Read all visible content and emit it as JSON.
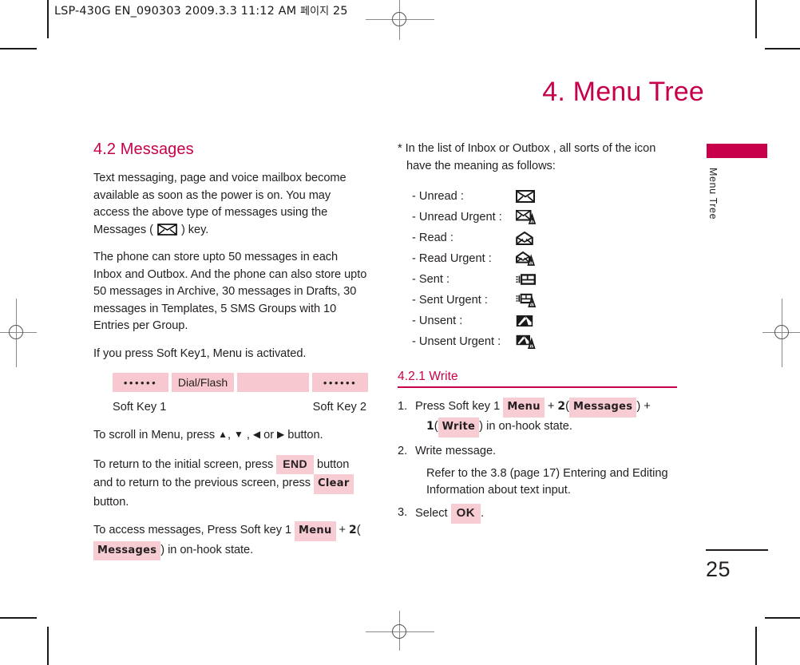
{
  "proof_header": {
    "text": "LSP-430G EN_090303  2009.3.3 11:12 AM",
    "korean": "페이지",
    "page": "25"
  },
  "chapter": {
    "title": "4. Menu Tree",
    "side_tab_label": "Menu Tree",
    "accent_color": "#c8004b",
    "chip_color": "#f7ccd3"
  },
  "left_column": {
    "section_title": "4.2 Messages",
    "paragraph_1_a": "Text messaging, page and voice mailbox become available as soon as the power is on. You may access the above type of messages using the Messages",
    "paragraph_1_b": ") key.",
    "paren_open": "(",
    "paragraph_2": "The phone can store upto 50 messages in each Inbox and Outbox. And the phone can also store upto 50 messages in Archive, 30 messages in Drafts, 30 messages in Templates, 5 SMS Groups with 10 Entries per Group.",
    "paragraph_3": "If you press Soft Key1, Menu is activated.",
    "softkey_strip": {
      "cell_1": "••••••",
      "cell_2": "Dial/Flash",
      "cell_3": "",
      "cell_4": "••••••",
      "left_label": "Soft Key 1",
      "right_label": "Soft Key 2"
    },
    "scroll_line": {
      "prefix": "To scroll in Menu, press ",
      "up": "▲",
      "sep1": ", ",
      "down": "▼",
      "sep2": " , ",
      "left": "◀",
      "sep3": " or ",
      "right": "▶",
      "suffix": " button."
    },
    "return_line": {
      "a": "To return to the initial screen, press ",
      "key_end": "END",
      "b": " button and to return to the previous screen, press ",
      "key_clear": "Clear",
      "c": " button."
    },
    "access_line": {
      "a": "To access messages, Press Soft key 1 ",
      "key_menu": "Menu",
      "b": " + ",
      "num2": "2",
      "paren_open": "(",
      "key_messages": "Messages",
      "paren_close": ")",
      "c": " in on-hook state."
    }
  },
  "right_column": {
    "note_line_1": "* In the list of Inbox or Outbox , all sorts of the icon",
    "note_line_2": "have the meaning as follows:",
    "legend": [
      {
        "label": "- Unread :",
        "icon": "envelope-closed-icon"
      },
      {
        "label": "- Unread Urgent :",
        "icon": "envelope-closed-urgent-icon"
      },
      {
        "label": "- Read :",
        "icon": "envelope-open-icon"
      },
      {
        "label": "- Read Urgent :",
        "icon": "envelope-open-urgent-icon"
      },
      {
        "label": "- Sent :",
        "icon": "sent-message-icon"
      },
      {
        "label": "- Sent Urgent :",
        "icon": "sent-message-urgent-icon"
      },
      {
        "label": "- Unsent :",
        "icon": "unsent-message-icon"
      },
      {
        "label": "- Unsent Urgent :",
        "icon": "unsent-message-urgent-icon"
      }
    ],
    "subsection_title": "4.2.1 Write",
    "steps": {
      "step1": {
        "num": "1.",
        "a": "Press Soft key 1 ",
        "key_menu": "Menu",
        "b": " + ",
        "num2": "2",
        "paren_open_1": "(",
        "key_messages": "Messages",
        "paren_close_1": ")",
        "c": " + ",
        "num1": "1",
        "paren_open_2": "(",
        "key_write": "Write",
        "paren_close_2": ")",
        "d": " in on-hook state."
      },
      "step2": {
        "num": "2.",
        "text": "Write message.",
        "note": "Refer to the 3.8 (page 17) Entering and Editing Information about text input."
      },
      "step3": {
        "num": "3.",
        "a": "Select ",
        "key_ok": "OK",
        "b": "."
      }
    }
  },
  "footer": {
    "page_number": "25"
  }
}
